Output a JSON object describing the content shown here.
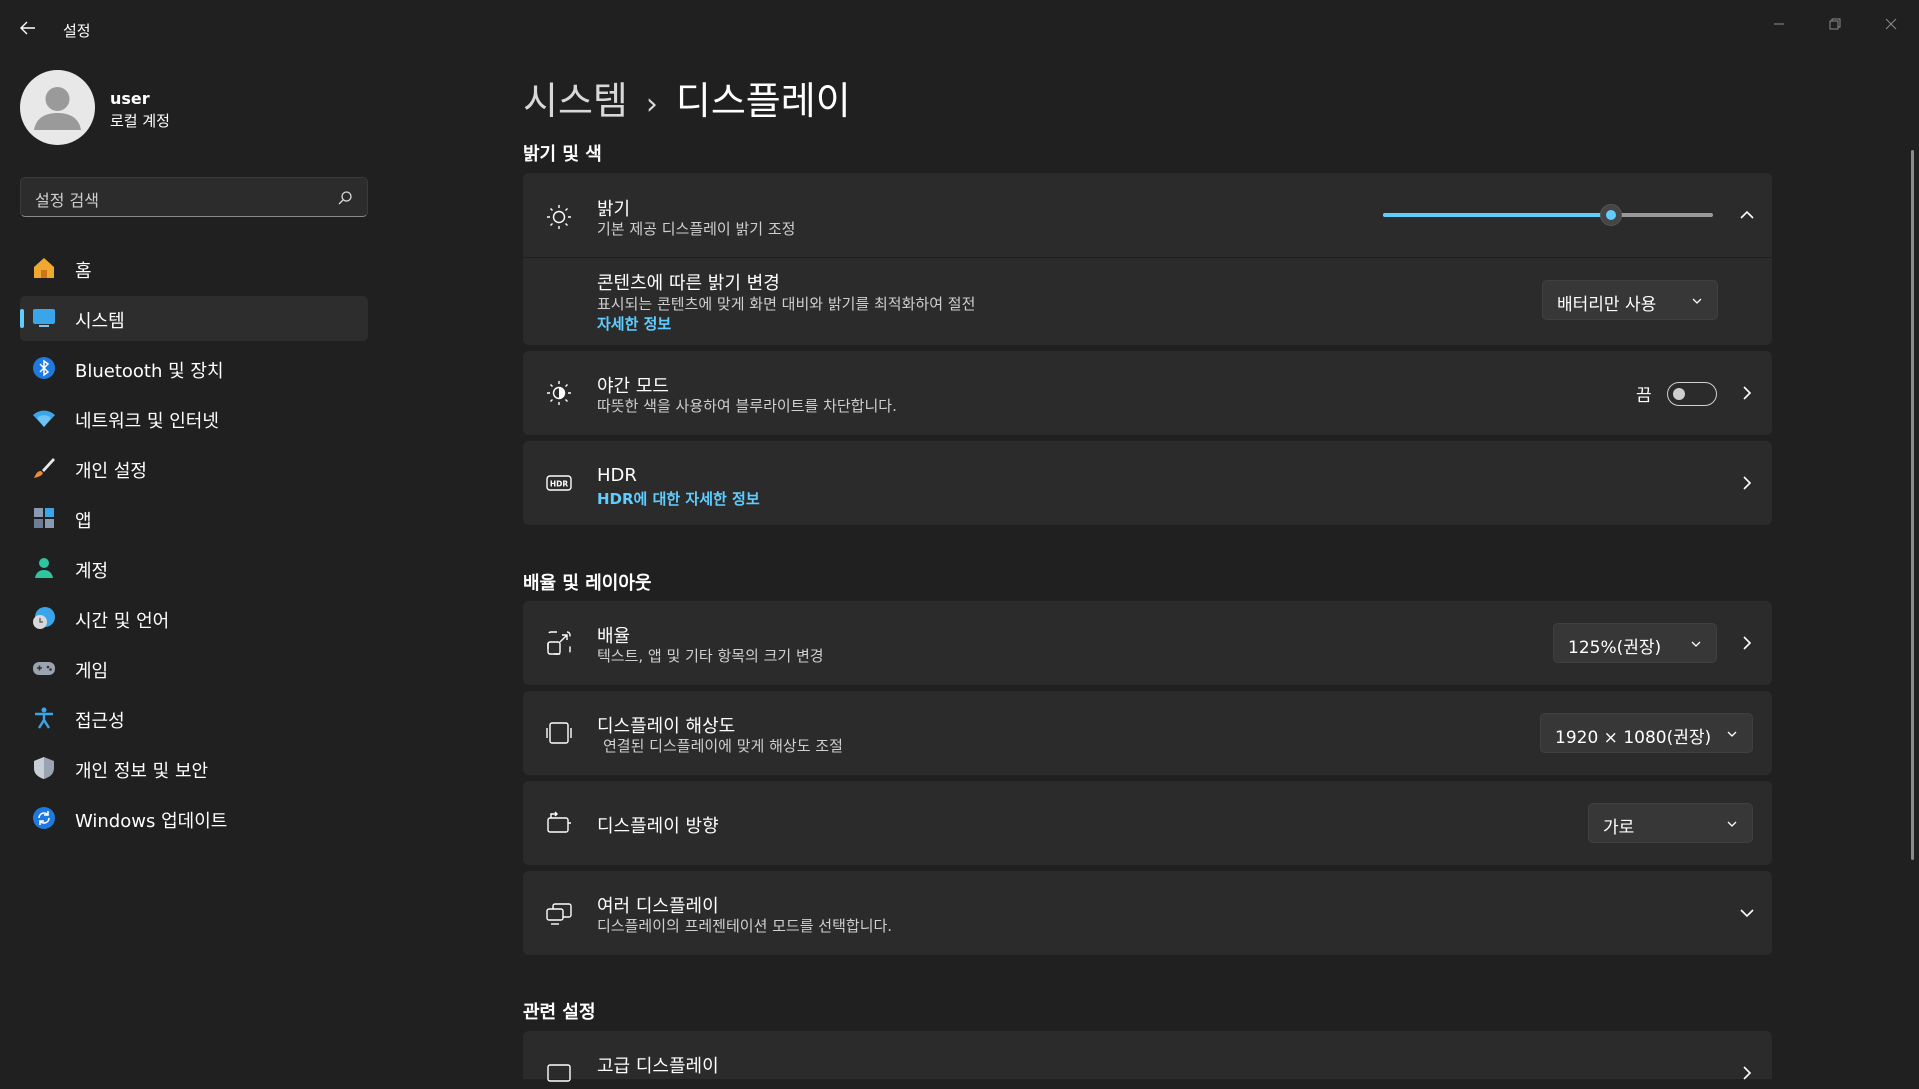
{
  "window": {
    "title": "설정"
  },
  "account": {
    "name": "user",
    "type": "로컬 계정"
  },
  "search": {
    "placeholder": "설정 검색"
  },
  "sidebar": {
    "items": [
      {
        "label": "홈"
      },
      {
        "label": "시스템"
      },
      {
        "label": "Bluetooth 및 장치"
      },
      {
        "label": "네트워크 및 인터넷"
      },
      {
        "label": "개인 설정"
      },
      {
        "label": "앱"
      },
      {
        "label": "계정"
      },
      {
        "label": "시간 및 언어"
      },
      {
        "label": "게임"
      },
      {
        "label": "접근성"
      },
      {
        "label": "개인 정보 및 보안"
      },
      {
        "label": "Windows 업데이트"
      }
    ]
  },
  "breadcrumb": {
    "parent": "시스템",
    "separator": "›",
    "current": "디스플레이"
  },
  "sections": {
    "brightness_color": "밝기 및 색",
    "scale_layout": "배율 및 레이아웃",
    "related": "관련 설정"
  },
  "brightness": {
    "title": "밝기",
    "subtitle": "기본 제공 디스플레이 밝기 조정",
    "level_percent": 69
  },
  "content_brightness": {
    "title": "콘텐츠에 따른 밝기 변경",
    "subtitle": "표시되는 콘텐츠에 맞게 화면 대비와 밝기를 최적화하여 절전",
    "link": "자세한 정보",
    "value": "배터리만 사용"
  },
  "night_light": {
    "title": "야간 모드",
    "subtitle": "따뜻한 색을 사용하여 블루라이트를 차단합니다.",
    "state": "끔"
  },
  "hdr": {
    "title": "HDR",
    "link": "HDR에 대한 자세한 정보"
  },
  "scale": {
    "title": "배율",
    "subtitle": "텍스트, 앱 및 기타 항목의 크기 변경",
    "value": "125%(권장)"
  },
  "resolution": {
    "title": "디스플레이 해상도",
    "subtitle": "연결된 디스플레이에 맞게 해상도 조절",
    "value": "1920 × 1080(권장)"
  },
  "orientation": {
    "title": "디스플레이 방향",
    "value": "가로"
  },
  "multi_display": {
    "title": "여러 디스플레이",
    "subtitle": "디스플레이의 프레젠테이션 모드를 선택합니다."
  },
  "advanced_display": {
    "title": "고급 디스플레이"
  },
  "colors": {
    "accent": "#60cdff",
    "background": "#202020",
    "card": "#2b2b2b"
  }
}
